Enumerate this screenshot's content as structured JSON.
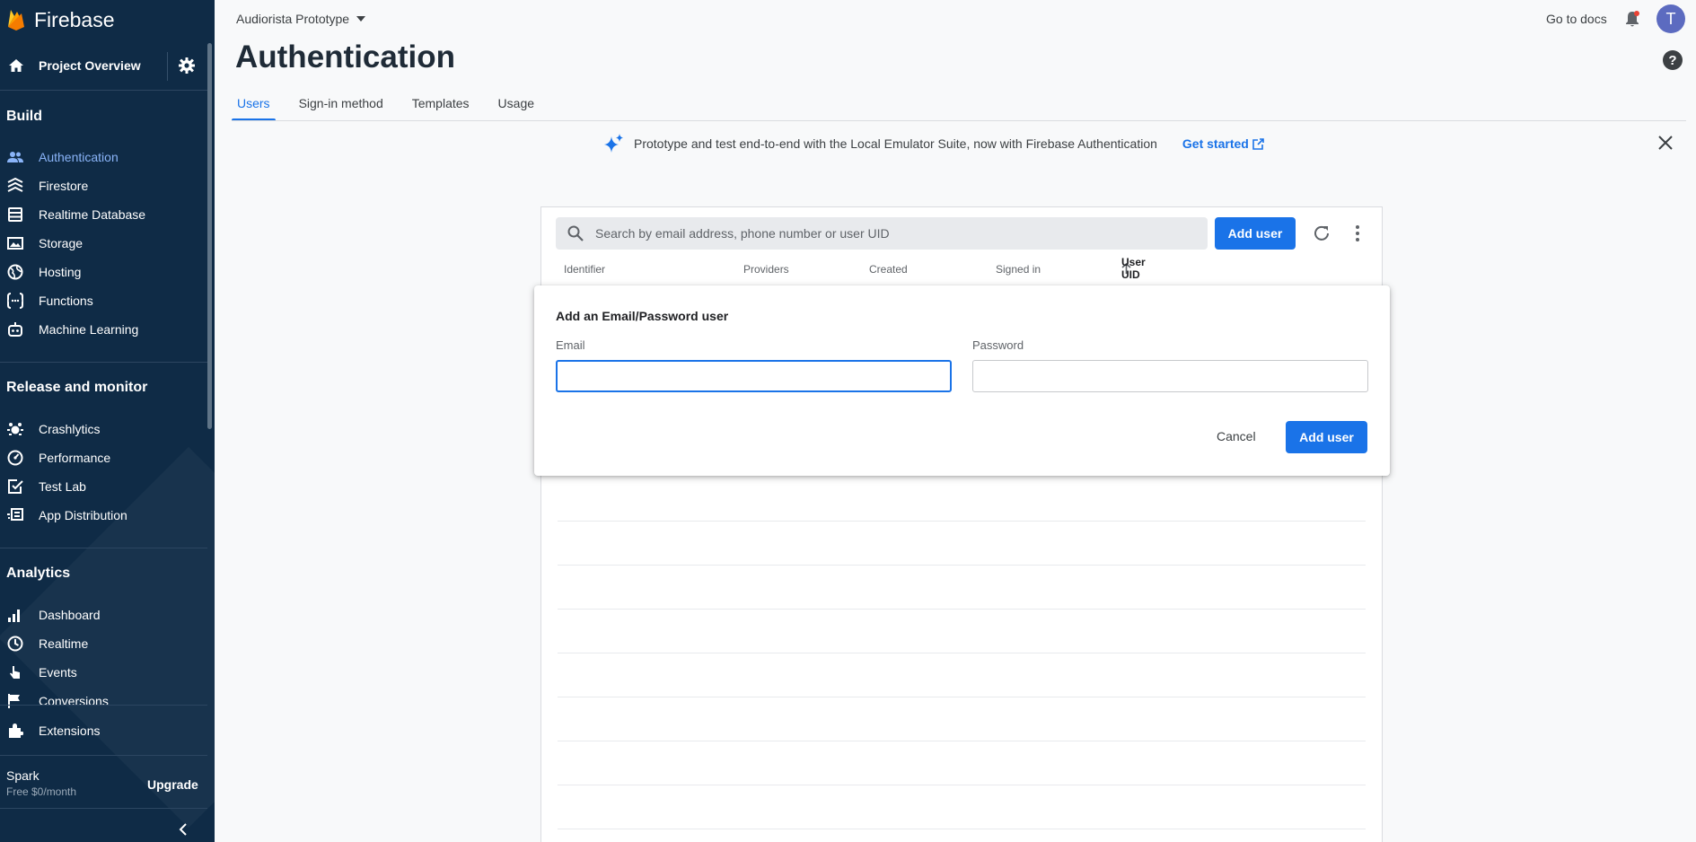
{
  "sidebar": {
    "brand": "Firebase",
    "project_overview": "Project Overview",
    "sections": {
      "build": "Build",
      "release": "Release and monitor",
      "analytics": "Analytics"
    },
    "build_items": [
      {
        "label": "Authentication",
        "icon": "users-icon"
      },
      {
        "label": "Firestore",
        "icon": "firestore-icon"
      },
      {
        "label": "Realtime Database",
        "icon": "database-icon"
      },
      {
        "label": "Storage",
        "icon": "image-icon"
      },
      {
        "label": "Hosting",
        "icon": "globe-icon"
      },
      {
        "label": "Functions",
        "icon": "functions-icon"
      },
      {
        "label": "Machine Learning",
        "icon": "robot-icon"
      }
    ],
    "release_items": [
      {
        "label": "Crashlytics",
        "icon": "crashlytics-icon"
      },
      {
        "label": "Performance",
        "icon": "speedometer-icon"
      },
      {
        "label": "Test Lab",
        "icon": "checklist-icon"
      },
      {
        "label": "App Distribution",
        "icon": "app-distribution-icon"
      }
    ],
    "analytics_items": [
      {
        "label": "Dashboard",
        "icon": "bar-chart-icon"
      },
      {
        "label": "Realtime",
        "icon": "clock-icon"
      },
      {
        "label": "Events",
        "icon": "touch-icon"
      },
      {
        "label": "Conversions",
        "icon": "flag-icon"
      }
    ],
    "extensions": "Extensions",
    "plan": {
      "name": "Spark",
      "price": "Free $0/month"
    },
    "upgrade": "Upgrade"
  },
  "header": {
    "project_name": "Audiorista Prototype",
    "go_to_docs": "Go to docs",
    "avatar_letter": "T"
  },
  "page": {
    "title": "Authentication",
    "tabs": [
      "Users",
      "Sign-in method",
      "Templates",
      "Usage"
    ],
    "active_tab": "Users"
  },
  "banner": {
    "text": "Prototype and test end-to-end with the Local Emulator Suite, now with Firebase Authentication",
    "link": "Get started"
  },
  "users_table": {
    "search_placeholder": "Search by email address, phone number or user UID",
    "add_user": "Add user",
    "columns": [
      "Identifier",
      "Providers",
      "Created",
      "Signed in",
      "User UID"
    ],
    "sorted_column": "User UID"
  },
  "dialog": {
    "title": "Add an Email/Password user",
    "email_label": "Email",
    "email_value": "",
    "password_label": "Password",
    "password_value": "",
    "cancel": "Cancel",
    "submit": "Add user"
  },
  "colors": {
    "sidebar_bg": "#0f2b46",
    "accent": "#1a73e8",
    "active_nav": "#8ab4f8",
    "avatar": "#5c6bc0"
  }
}
